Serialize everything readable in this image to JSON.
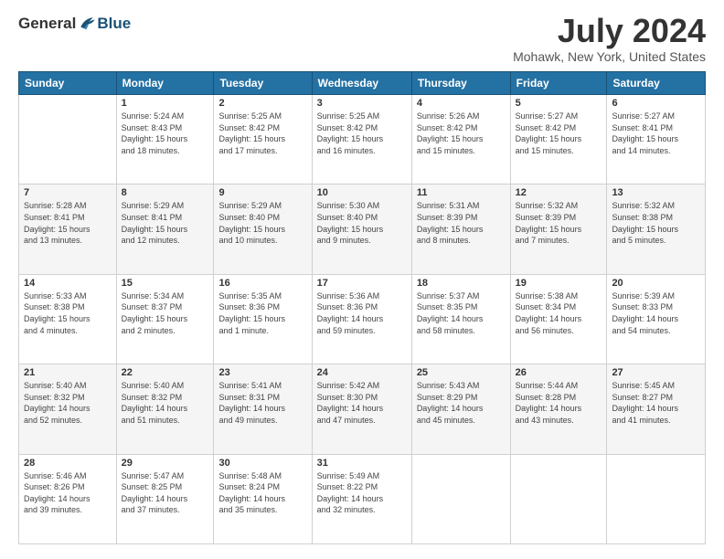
{
  "logo": {
    "general": "General",
    "blue": "Blue"
  },
  "title": "July 2024",
  "location": "Mohawk, New York, United States",
  "days_header": [
    "Sunday",
    "Monday",
    "Tuesday",
    "Wednesday",
    "Thursday",
    "Friday",
    "Saturday"
  ],
  "weeks": [
    [
      {
        "day": "",
        "info": ""
      },
      {
        "day": "1",
        "info": "Sunrise: 5:24 AM\nSunset: 8:43 PM\nDaylight: 15 hours\nand 18 minutes."
      },
      {
        "day": "2",
        "info": "Sunrise: 5:25 AM\nSunset: 8:42 PM\nDaylight: 15 hours\nand 17 minutes."
      },
      {
        "day": "3",
        "info": "Sunrise: 5:25 AM\nSunset: 8:42 PM\nDaylight: 15 hours\nand 16 minutes."
      },
      {
        "day": "4",
        "info": "Sunrise: 5:26 AM\nSunset: 8:42 PM\nDaylight: 15 hours\nand 15 minutes."
      },
      {
        "day": "5",
        "info": "Sunrise: 5:27 AM\nSunset: 8:42 PM\nDaylight: 15 hours\nand 15 minutes."
      },
      {
        "day": "6",
        "info": "Sunrise: 5:27 AM\nSunset: 8:41 PM\nDaylight: 15 hours\nand 14 minutes."
      }
    ],
    [
      {
        "day": "7",
        "info": "Sunrise: 5:28 AM\nSunset: 8:41 PM\nDaylight: 15 hours\nand 13 minutes."
      },
      {
        "day": "8",
        "info": "Sunrise: 5:29 AM\nSunset: 8:41 PM\nDaylight: 15 hours\nand 12 minutes."
      },
      {
        "day": "9",
        "info": "Sunrise: 5:29 AM\nSunset: 8:40 PM\nDaylight: 15 hours\nand 10 minutes."
      },
      {
        "day": "10",
        "info": "Sunrise: 5:30 AM\nSunset: 8:40 PM\nDaylight: 15 hours\nand 9 minutes."
      },
      {
        "day": "11",
        "info": "Sunrise: 5:31 AM\nSunset: 8:39 PM\nDaylight: 15 hours\nand 8 minutes."
      },
      {
        "day": "12",
        "info": "Sunrise: 5:32 AM\nSunset: 8:39 PM\nDaylight: 15 hours\nand 7 minutes."
      },
      {
        "day": "13",
        "info": "Sunrise: 5:32 AM\nSunset: 8:38 PM\nDaylight: 15 hours\nand 5 minutes."
      }
    ],
    [
      {
        "day": "14",
        "info": "Sunrise: 5:33 AM\nSunset: 8:38 PM\nDaylight: 15 hours\nand 4 minutes."
      },
      {
        "day": "15",
        "info": "Sunrise: 5:34 AM\nSunset: 8:37 PM\nDaylight: 15 hours\nand 2 minutes."
      },
      {
        "day": "16",
        "info": "Sunrise: 5:35 AM\nSunset: 8:36 PM\nDaylight: 15 hours\nand 1 minute."
      },
      {
        "day": "17",
        "info": "Sunrise: 5:36 AM\nSunset: 8:36 PM\nDaylight: 14 hours\nand 59 minutes."
      },
      {
        "day": "18",
        "info": "Sunrise: 5:37 AM\nSunset: 8:35 PM\nDaylight: 14 hours\nand 58 minutes."
      },
      {
        "day": "19",
        "info": "Sunrise: 5:38 AM\nSunset: 8:34 PM\nDaylight: 14 hours\nand 56 minutes."
      },
      {
        "day": "20",
        "info": "Sunrise: 5:39 AM\nSunset: 8:33 PM\nDaylight: 14 hours\nand 54 minutes."
      }
    ],
    [
      {
        "day": "21",
        "info": "Sunrise: 5:40 AM\nSunset: 8:32 PM\nDaylight: 14 hours\nand 52 minutes."
      },
      {
        "day": "22",
        "info": "Sunrise: 5:40 AM\nSunset: 8:32 PM\nDaylight: 14 hours\nand 51 minutes."
      },
      {
        "day": "23",
        "info": "Sunrise: 5:41 AM\nSunset: 8:31 PM\nDaylight: 14 hours\nand 49 minutes."
      },
      {
        "day": "24",
        "info": "Sunrise: 5:42 AM\nSunset: 8:30 PM\nDaylight: 14 hours\nand 47 minutes."
      },
      {
        "day": "25",
        "info": "Sunrise: 5:43 AM\nSunset: 8:29 PM\nDaylight: 14 hours\nand 45 minutes."
      },
      {
        "day": "26",
        "info": "Sunrise: 5:44 AM\nSunset: 8:28 PM\nDaylight: 14 hours\nand 43 minutes."
      },
      {
        "day": "27",
        "info": "Sunrise: 5:45 AM\nSunset: 8:27 PM\nDaylight: 14 hours\nand 41 minutes."
      }
    ],
    [
      {
        "day": "28",
        "info": "Sunrise: 5:46 AM\nSunset: 8:26 PM\nDaylight: 14 hours\nand 39 minutes."
      },
      {
        "day": "29",
        "info": "Sunrise: 5:47 AM\nSunset: 8:25 PM\nDaylight: 14 hours\nand 37 minutes."
      },
      {
        "day": "30",
        "info": "Sunrise: 5:48 AM\nSunset: 8:24 PM\nDaylight: 14 hours\nand 35 minutes."
      },
      {
        "day": "31",
        "info": "Sunrise: 5:49 AM\nSunset: 8:22 PM\nDaylight: 14 hours\nand 32 minutes."
      },
      {
        "day": "",
        "info": ""
      },
      {
        "day": "",
        "info": ""
      },
      {
        "day": "",
        "info": ""
      }
    ]
  ]
}
